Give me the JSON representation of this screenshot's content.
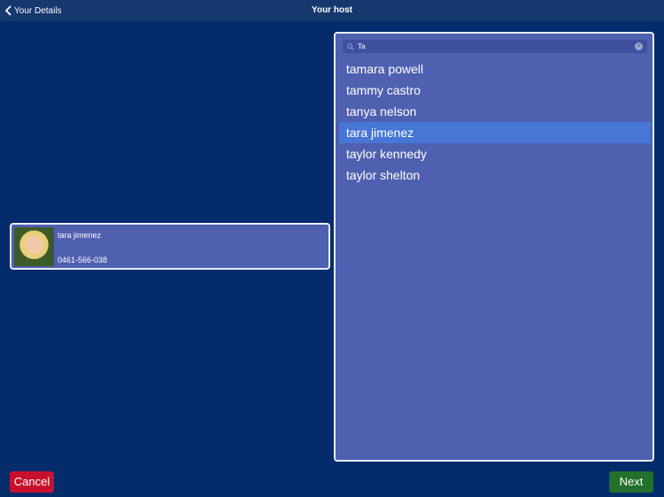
{
  "nav": {
    "back_label": "Your Details",
    "title": "Your host"
  },
  "selected_host": {
    "name": "tara jimenez",
    "phone": "0461-566-038"
  },
  "search": {
    "value": "Ta"
  },
  "results": [
    {
      "label": "tamara powell",
      "selected": false
    },
    {
      "label": "tammy castro",
      "selected": false
    },
    {
      "label": "tanya nelson",
      "selected": false
    },
    {
      "label": "tara jimenez",
      "selected": true
    },
    {
      "label": "taylor kennedy",
      "selected": false
    },
    {
      "label": "taylor shelton",
      "selected": false
    }
  ],
  "footer": {
    "cancel_label": "Cancel",
    "next_label": "Next"
  },
  "colors": {
    "background": "#042c6c",
    "panel": "#5060b0",
    "selected": "#4676d6",
    "cancel": "#c8102e",
    "next": "#22702c"
  }
}
